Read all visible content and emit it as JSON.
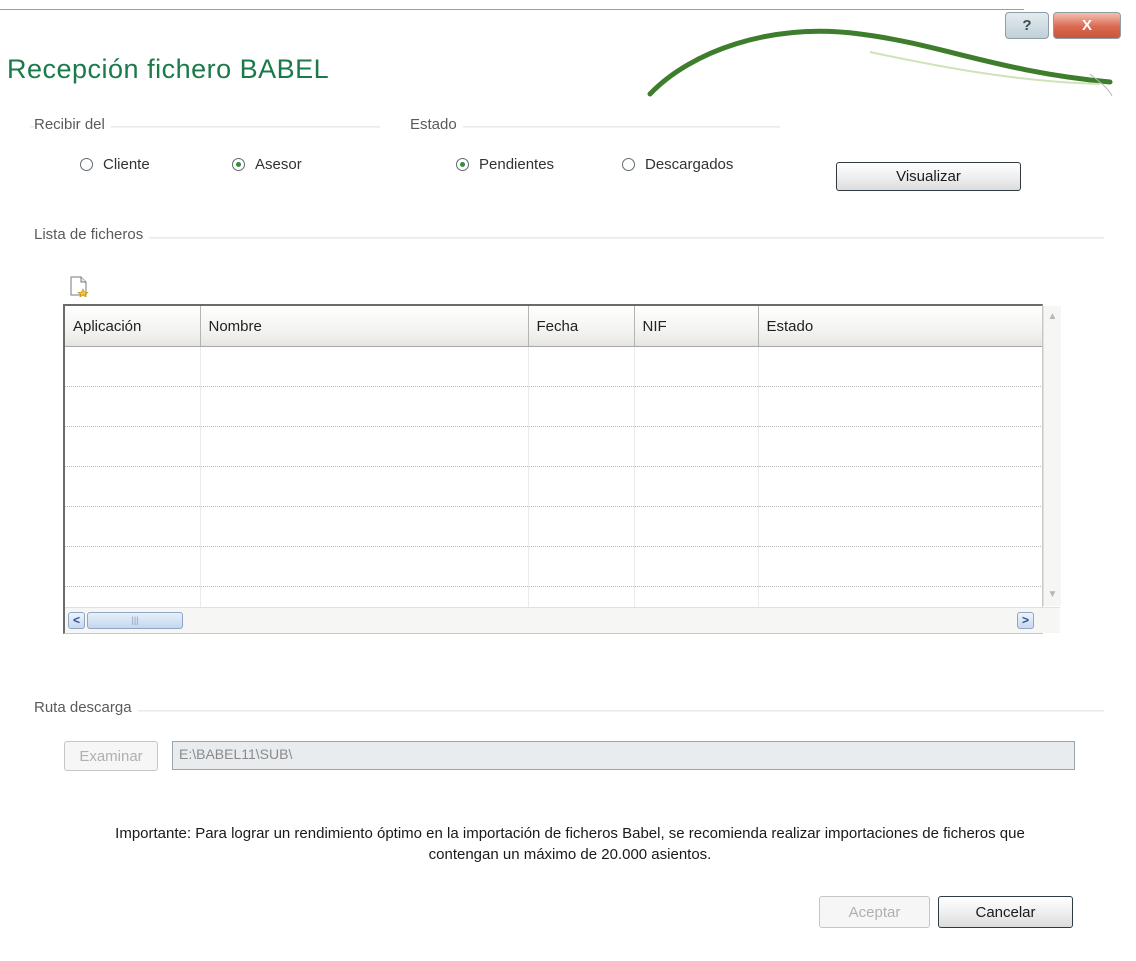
{
  "window": {
    "title": "Recepción fichero BABEL",
    "help_label": "?",
    "close_label": "X"
  },
  "recibir": {
    "label": "Recibir del",
    "options": [
      {
        "label": "Cliente",
        "checked": false
      },
      {
        "label": "Asesor",
        "checked": true
      }
    ]
  },
  "estado": {
    "label": "Estado",
    "options": [
      {
        "label": "Pendientes",
        "checked": true
      },
      {
        "label": "Descargados",
        "checked": false
      }
    ]
  },
  "visualizar_label": "Visualizar",
  "lista": {
    "label": "Lista de ficheros",
    "toolbar_icon": "new-document-icon",
    "columns": [
      "Aplicación",
      "Nombre",
      "Fecha",
      "NIF",
      "Estado"
    ],
    "rows": []
  },
  "ruta": {
    "label": "Ruta descarga",
    "examinar_label": "Examinar",
    "path_value": "E:\\BABEL11\\SUB\\"
  },
  "notice": {
    "line1": "Importante: Para lograr un rendimiento óptimo en la importación de ficheros Babel, se recomienda realizar importaciones de ficheros que",
    "line2": "contengan un máximo de 20.000 asientos."
  },
  "footer": {
    "aceptar_label": "Aceptar",
    "cancelar_label": "Cancelar"
  },
  "colors": {
    "title_green": "#1a7a4a",
    "radio_dot_green": "#3a8a3a",
    "close_red": "#d9694f"
  }
}
